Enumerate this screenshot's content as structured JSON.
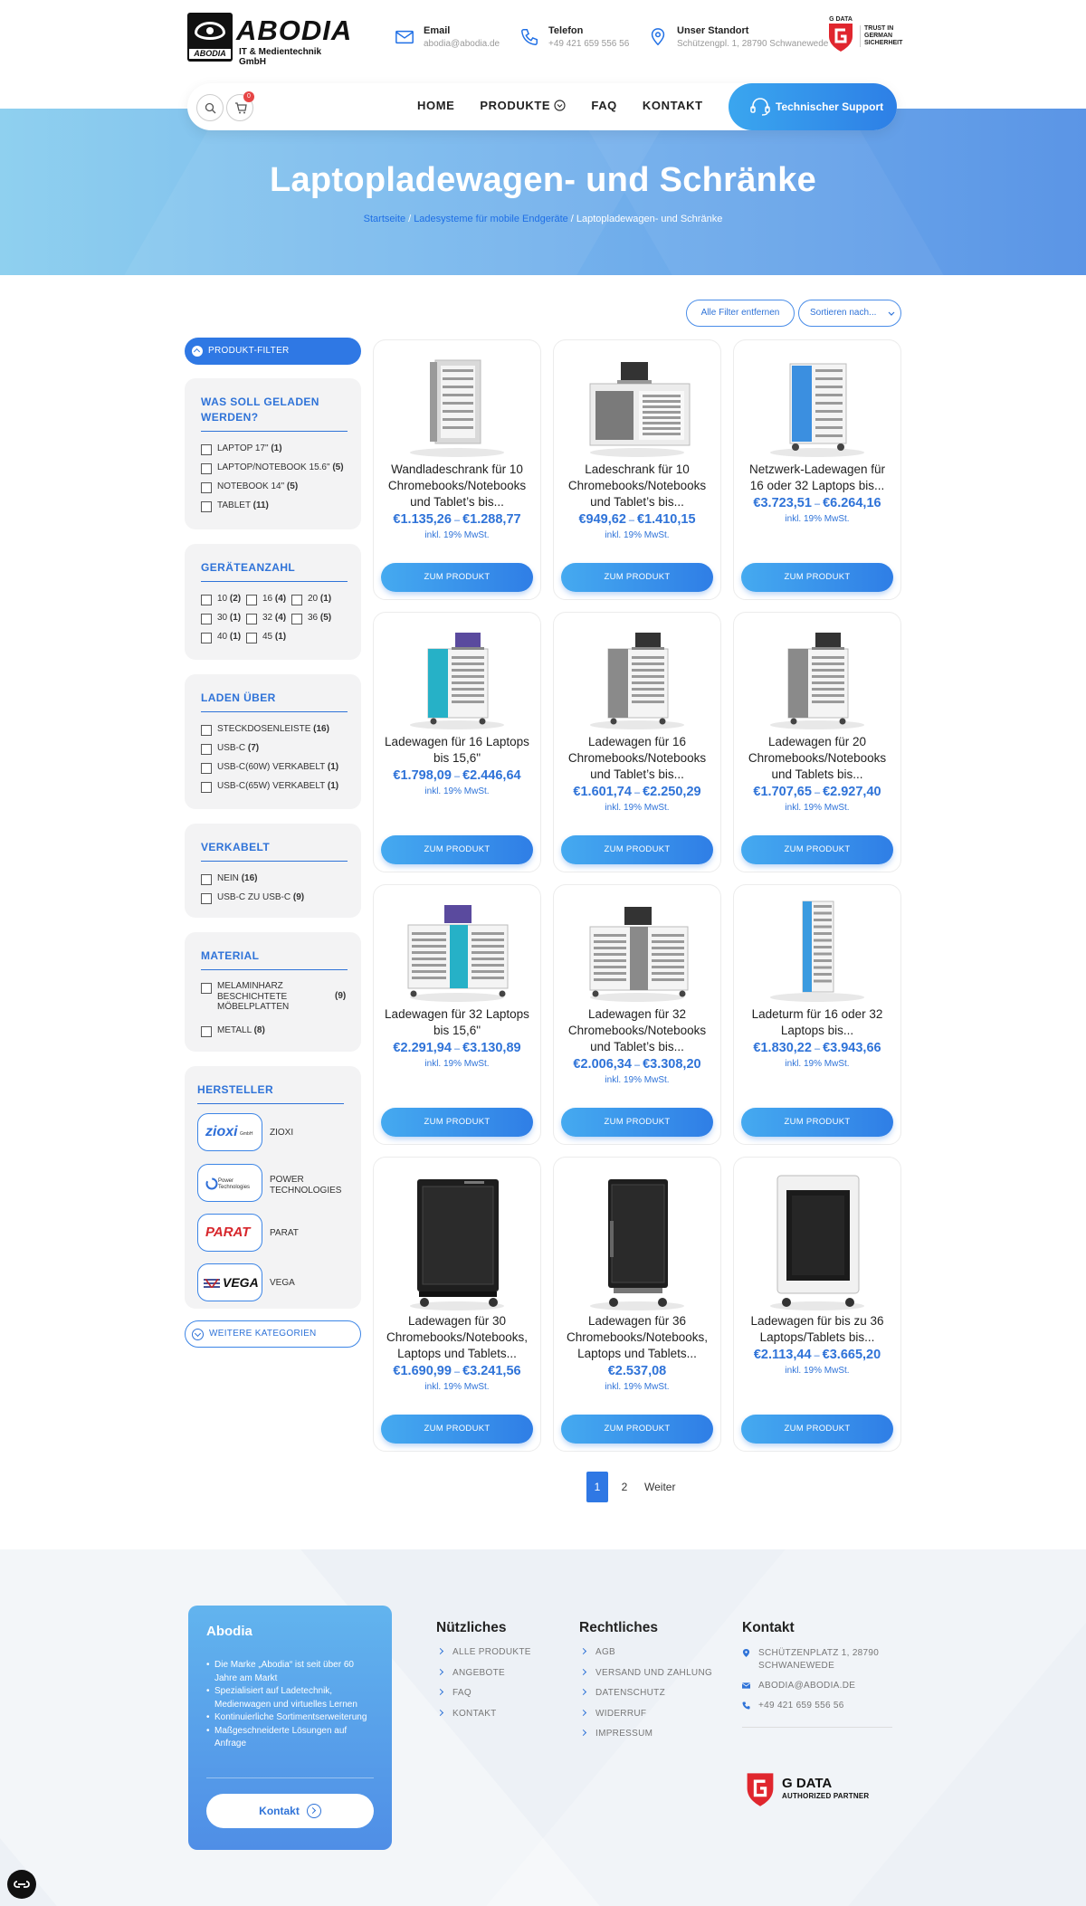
{
  "header": {
    "brand": "ABODIA",
    "brand_small": "ABODIA",
    "brand_sub": "IT & Medientechnik GmbH",
    "email_label": "Email",
    "email_value": "abodia@abodia.de",
    "phone_label": "Telefon",
    "phone_value": "+49 421 659 556 56",
    "location_label": "Unser Standort",
    "location_value": "Schützengpl. 1, 28790 Schwanewede",
    "gdata_small": "G DATA",
    "trust_line1": "TRUST IN",
    "trust_line2": "GERMAN",
    "trust_line3": "SICHERHEIT"
  },
  "nav": {
    "cart_count": "0",
    "items": [
      "HOME",
      "PRODUKTE",
      "FAQ",
      "KONTAKT"
    ],
    "support_label": "Technischer Support"
  },
  "hero": {
    "title": "Laptopladewagen- und Schränke",
    "crumb1": "Startseite",
    "crumb2": "Ladesysteme für mobile Endgeräte",
    "crumb3": "Laptopladewagen- und Schränke"
  },
  "actions": {
    "remove_filters": "Alle Filter entfernen",
    "sort": "Sortieren nach..."
  },
  "sidebar": {
    "filter_head": "PRODUKT-FILTER",
    "p1_title": "WAS SOLL GELADEN WERDEN?",
    "p1_opts": [
      {
        "label": "LAPTOP 17\"",
        "count": "(1)"
      },
      {
        "label": "LAPTOP/NOTEBOOK 15.6\"",
        "count": "(5)"
      },
      {
        "label": "NOTEBOOK 14\"",
        "count": "(5)"
      },
      {
        "label": "TABLET",
        "count": "(11)"
      }
    ],
    "p2_title": "GERÄTEANZAHL",
    "p2_opts": [
      {
        "label": "10",
        "count": "(2)"
      },
      {
        "label": "16",
        "count": "(4)"
      },
      {
        "label": "20",
        "count": "(1)"
      },
      {
        "label": "30",
        "count": "(1)"
      },
      {
        "label": "32",
        "count": "(4)"
      },
      {
        "label": "36",
        "count": "(5)"
      },
      {
        "label": "40",
        "count": "(1)"
      },
      {
        "label": "45",
        "count": "(1)"
      }
    ],
    "p3_title": "LADEN ÜBER",
    "p3_opts": [
      {
        "label": "STECKDOSENLEISTE",
        "count": "(16)"
      },
      {
        "label": "USB-C",
        "count": "(7)"
      },
      {
        "label": "USB-C(60W) VERKABELT",
        "count": "(1)"
      },
      {
        "label": "USB-C(65W) VERKABELT",
        "count": "(1)"
      }
    ],
    "p4_title": "VERKABELT",
    "p4_opts": [
      {
        "label": "NEIN",
        "count": "(16)"
      },
      {
        "label": "USB-C ZU USB-C",
        "count": "(9)"
      }
    ],
    "p5_title": "MATERIAL",
    "p5_opt1_l1": "MELAMINHARZ",
    "p5_opt1_l2": "BESCHICHTETE",
    "p5_opt1_l3": "MÖBELPLATTEN",
    "p5_opt1_count": "(9)",
    "p5_opt2": "METALL",
    "p5_opt2_count": "(8)",
    "p6_title": "HERSTELLER",
    "brands": [
      {
        "logo": "zioxi",
        "logo_sub": "GmbH",
        "name": "ZIOXI"
      },
      {
        "logo": "Power Technologies",
        "name_l1": "POWER",
        "name_l2": "TECHNOLOGIES"
      },
      {
        "logo": "PARAT",
        "name": "PARAT"
      },
      {
        "logo": "VEGA",
        "name": "VEGA"
      }
    ],
    "more": "WEITERE KATEGORIEN"
  },
  "products": [
    {
      "t1": "Wandladeschrank für 10",
      "t2": "Chromebooks/Notebooks",
      "t3": "und Tablet’s bis...",
      "p1": "€1.135,26",
      "p2": "€1.288,77"
    },
    {
      "t1": "Ladeschrank für 10",
      "t2": "Chromebooks/Notebooks",
      "t3": "und Tablet’s bis...",
      "p1": "€949,62",
      "p2": "€1.410,15"
    },
    {
      "t1": "Netzwerk-Ladewagen für",
      "t2": "16 oder 32 Laptops bis...",
      "t3": "",
      "p1": "€3.723,51",
      "p2": "€6.264,16"
    },
    {
      "t1": "Ladewagen für 16 Laptops",
      "t2": "bis 15,6\"",
      "t3": "",
      "p1": "€1.798,09",
      "p2": "€2.446,64"
    },
    {
      "t1": "Ladewagen für 16",
      "t2": "Chromebooks/Notebooks",
      "t3": "und Tablet’s bis...",
      "p1": "€1.601,74",
      "p2": "€2.250,29"
    },
    {
      "t1": "Ladewagen für 20",
      "t2": "Chromebooks/Notebooks",
      "t3": "und Tablets bis...",
      "p1": "€1.707,65",
      "p2": "€2.927,40"
    },
    {
      "t1": "Ladewagen für 32 Laptops",
      "t2": "bis 15,6\"",
      "t3": "",
      "p1": "€2.291,94",
      "p2": "€3.130,89"
    },
    {
      "t1": "Ladewagen für 32",
      "t2": "Chromebooks/Notebooks",
      "t3": "und Tablet’s bis...",
      "p1": "€2.006,34",
      "p2": "€3.308,20"
    },
    {
      "t1": "Ladeturm für 16 oder 32",
      "t2": "Laptops bis...",
      "t3": "",
      "p1": "€1.830,22",
      "p2": "€3.943,66"
    },
    {
      "t1": "Ladewagen für 30",
      "t2": "Chromebooks/Notebooks,",
      "t3": "Laptops und Tablets...",
      "p1": "€1.690,99",
      "p2": "€3.241,56"
    },
    {
      "t1": "Ladewagen für 36",
      "t2": "Chromebooks/Notebooks,",
      "t3": "Laptops und Tablets...",
      "p1": "€2.537,08",
      "p2": ""
    },
    {
      "t1": "Ladewagen für bis zu 36",
      "t2": "Laptops/Tablets bis...",
      "t3": "",
      "p1": "€2.113,44",
      "p2": "€3.665,20"
    }
  ],
  "product_common": {
    "dash": "–",
    "tax": "inkl. 19% MwSt.",
    "button": "ZUM PRODUKT"
  },
  "pagination": {
    "current": "1",
    "page2": "2",
    "next": "Weiter"
  },
  "footer": {
    "box_title": "Abodia",
    "box_items": [
      "Die Marke „Abodia“ ist seit über 60 Jahre am Markt",
      "Spezialisiert auf Ladetechnik, Medienwagen und virtuelles Lernen",
      "Kontinuierliche Sortimentserweiterung",
      "Maßgeschneiderte Lösungen auf Anfrage"
    ],
    "box_button": "Kontakt",
    "col1_title": "Nützliches",
    "col1": [
      "ALLE PRODUKTE",
      "ANGEBOTE",
      "FAQ",
      "KONTAKT"
    ],
    "col2_title": "Rechtliches",
    "col2": [
      "AGB",
      "VERSAND UND ZAHLUNG",
      "DATENSCHUTZ",
      "WIDERRUF",
      "IMPRESSUM"
    ],
    "col3_title": "Kontakt",
    "addr_l1": "SCHÜTZENPLATZ 1, 28790",
    "addr_l2": "SCHWANEWEDE",
    "mail": "ABODIA@ABODIA.DE",
    "phone": "+49 421 659 556 56",
    "gdata_title": "G DATA",
    "gdata_sub": "AUTHORIZED PARTNER"
  },
  "colors": {
    "accent": "#2f78e4",
    "hero": "#74b2ec",
    "badge": "#e64545"
  }
}
